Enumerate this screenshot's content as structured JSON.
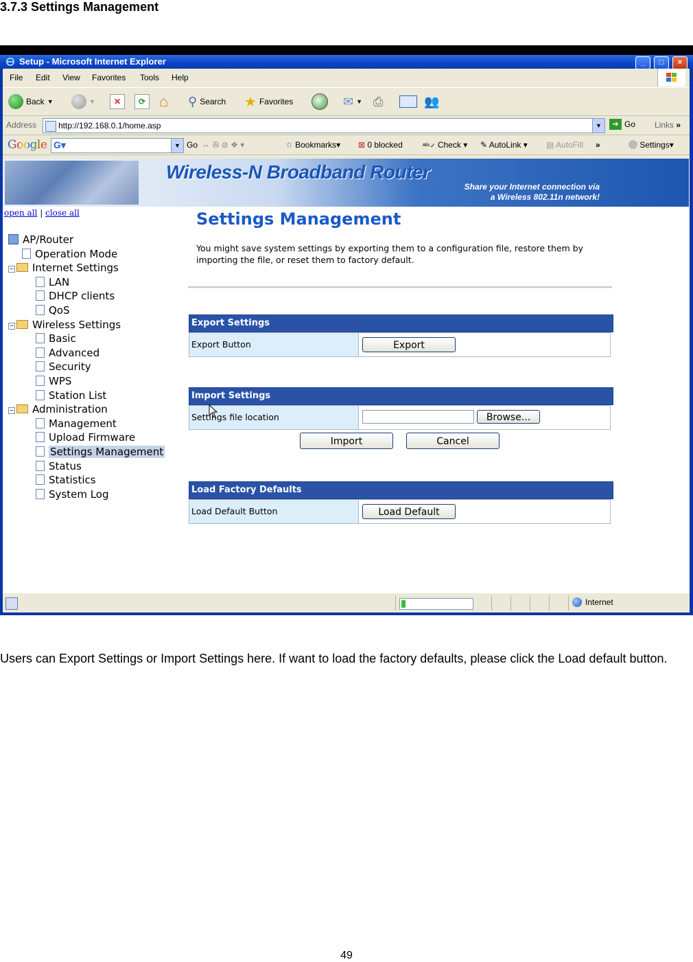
{
  "document": {
    "heading": "3.7.3 Settings Management",
    "paragraph": "Users can Export Settings or Import Settings here. If want to load the factory defaults, please click the Load default button.",
    "page_number": "49"
  },
  "window": {
    "title": "Setup - Microsoft Internet Explorer",
    "controls": [
      "_",
      "□",
      "×"
    ]
  },
  "menu": [
    "File",
    "Edit",
    "View",
    "Favorites",
    "Tools",
    "Help"
  ],
  "toolbar": {
    "back": "Back",
    "search": "Search",
    "favorites": "Favorites"
  },
  "address": {
    "label": "Address",
    "url": "http://192.168.0.1/home.asp",
    "go": "Go",
    "links": "Links",
    "more": "»"
  },
  "google_bar": {
    "logo": "Google",
    "go": "Go",
    "bookmarks": "Bookmarks",
    "blocked": "0 blocked",
    "check": "Check",
    "autolink": "AutoLink",
    "autofill": "AutoFill",
    "more": "»",
    "settings": "Settings"
  },
  "banner": {
    "title": "Wireless-N Broadband Router",
    "subtitle_line1": "Share your Internet connection via",
    "subtitle_line2": "a Wireless 802.11n network!"
  },
  "tree_links": {
    "open_all": "open all",
    "separator": "|",
    "close_all": "close all"
  },
  "tree": [
    {
      "label": "AP/Router",
      "icon": "pc",
      "depth": 0
    },
    {
      "label": "Operation Mode",
      "icon": "page",
      "depth": 1
    },
    {
      "label": "Internet Settings",
      "icon": "folder",
      "depth": 0
    },
    {
      "label": "LAN",
      "icon": "page",
      "depth": 2
    },
    {
      "label": "DHCP clients",
      "icon": "page",
      "depth": 2
    },
    {
      "label": "QoS",
      "icon": "page",
      "depth": 2
    },
    {
      "label": "Wireless Settings",
      "icon": "folder",
      "depth": 0
    },
    {
      "label": "Basic",
      "icon": "page",
      "depth": 2
    },
    {
      "label": "Advanced",
      "icon": "page",
      "depth": 2
    },
    {
      "label": "Security",
      "icon": "page",
      "depth": 2
    },
    {
      "label": "WPS",
      "icon": "page",
      "depth": 2
    },
    {
      "label": "Station List",
      "icon": "page",
      "depth": 2
    },
    {
      "label": "Administration",
      "icon": "folder",
      "depth": 0
    },
    {
      "label": "Management",
      "icon": "page",
      "depth": 2
    },
    {
      "label": "Upload Firmware",
      "icon": "page",
      "depth": 2
    },
    {
      "label": "Settings Management",
      "icon": "page",
      "depth": 2,
      "selected": true
    },
    {
      "label": "Status",
      "icon": "page",
      "depth": 2
    },
    {
      "label": "Statistics",
      "icon": "page",
      "depth": 2
    },
    {
      "label": "System Log",
      "icon": "page",
      "depth": 2
    }
  ],
  "content": {
    "title": "Settings Management",
    "description": "You might save system settings by exporting them to a configuration file, restore them by importing the file, or reset them to factory default.",
    "export": {
      "heading": "Export Settings",
      "row_label": "Export Button",
      "button": "Export"
    },
    "import": {
      "heading": "Import Settings",
      "row_label": "Settings file location",
      "browse": "Browse...",
      "import_button": "Import",
      "cancel_button": "Cancel"
    },
    "factory": {
      "heading": "Load Factory Defaults",
      "row_label": "Load Default Button",
      "button": "Load Default"
    }
  },
  "status_bar": {
    "zone": "Internet",
    "progress": 0.06
  }
}
